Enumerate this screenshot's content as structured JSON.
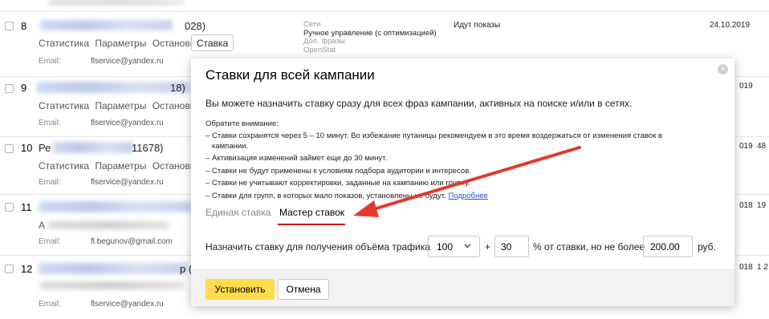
{
  "rows": [
    {
      "num": "8",
      "name_suffix": "028)",
      "links": [
        "Статистика",
        "Параметры",
        "Остановить"
      ],
      "stavka_button": "Ставка",
      "email_label": "Email:",
      "email": "flservice@yandex.ru",
      "meta": [
        "Сети",
        "Ручное управление (с оптимизацией)",
        "Доп. фразы",
        "OpenStat"
      ],
      "status": "Идут показы",
      "date": "24.10.2019"
    },
    {
      "num": "9",
      "name_suffix": "18)",
      "links": [
        "Статистика",
        "Параметры",
        "Остановить"
      ],
      "email_label": "Email:",
      "email": "flservice@yandex.ru",
      "date": "019"
    },
    {
      "num": "10",
      "name_prefix": "Ре",
      "name_suffix": "11678)",
      "links": [
        "Статистика",
        "Параметры",
        "Остановить"
      ],
      "email_label": "Email:",
      "email": "flservice@yandex.ru",
      "date": "019",
      "edge": "48"
    },
    {
      "num": "11",
      "links": [
        "А"
      ],
      "email_label": "Email:",
      "email": "fl.begunov@gmail.com",
      "date": "018",
      "edge": "19"
    },
    {
      "num": "12",
      "name_suffix": "р (Д",
      "links": [],
      "email_label": "Email:",
      "email": "flservice@yandex.ru",
      "date": "018",
      "edge": "1 2"
    }
  ],
  "modal": {
    "title": "Ставки для всей кампании",
    "intro": "Вы можете назначить ставку сразу для всех фраз кампании, активных на поиске и/или в сетях.",
    "notice_title": "Обратите внимание:",
    "notices": [
      "Ставки сохранятся через 5 – 10 минут. Во избежание путаницы рекомендуем в это время воздержаться от изменения ставок в кампании.",
      "Активизация изменений займет еще до 30 минут.",
      "Ставки не будут применены к условиям подбора аудитории и интересов.",
      "Ставки не учитывают корректировки, заданные на кампанию или группу.",
      "Ставки для групп, в которых мало показов, установлены не будут."
    ],
    "more_link": "Подробнее",
    "tabs": {
      "single": "Единая ставка",
      "master": "Мастер ставок"
    },
    "bid": {
      "label": "Назначить ставку для получения объёма трафика",
      "traffic_value": "100",
      "plus": "+",
      "percent_value": "30",
      "percent_label": "% от ставки, но не более",
      "max_value": "200.00",
      "currency": "руб."
    },
    "buttons": {
      "set": "Установить",
      "cancel": "Отмена"
    },
    "close_glyph": "×"
  },
  "colors": {
    "accent_yellow": "#ffdb4d",
    "tab_underline": "#d0021b",
    "arrow": "#e03a2f",
    "link": "#1a56c8"
  }
}
